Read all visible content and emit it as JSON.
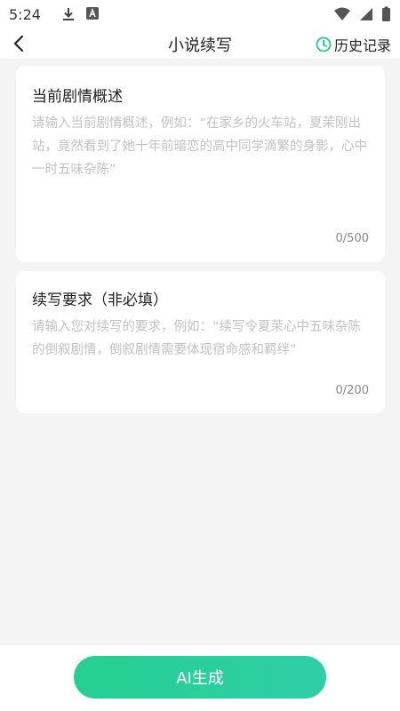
{
  "status_bar": {
    "time": "5:24",
    "icons": [
      "download-icon",
      "translate-app-icon",
      "wifi-icon",
      "cellular-signal-icon",
      "battery-icon"
    ]
  },
  "app_bar": {
    "back_icon": "chevron-left-icon",
    "title": "小说续写",
    "history_icon": "clock-icon",
    "history_label": "历史记录",
    "accent_color": "#25c98a"
  },
  "plot_card": {
    "title": "当前剧情概述",
    "value": "",
    "placeholder": "请输入当前剧情概述，例如：“在家乡的火车站，夏茉刚出站，竟然看到了她十年前暗恋的高中同学滴繁的身影，心中一时五味杂陈”",
    "counter": "0/500"
  },
  "requirement_card": {
    "title": "续写要求（非必填）",
    "value": "",
    "placeholder": "请输入您对续写的要求，例如：“续写令夏茉心中五味杂陈的倒叙剧情，倒叙剧情需要体现宿命感和羁绊”",
    "counter": "0/200"
  },
  "bottom": {
    "generate_label": "AI生成",
    "button_gradient": [
      "#25cf91",
      "#2fcfa7"
    ]
  },
  "colors": {
    "background": "#f4f4f4",
    "card": "#ffffff",
    "placeholder": "#c2c2c2",
    "counter": "#8a8a8a"
  }
}
